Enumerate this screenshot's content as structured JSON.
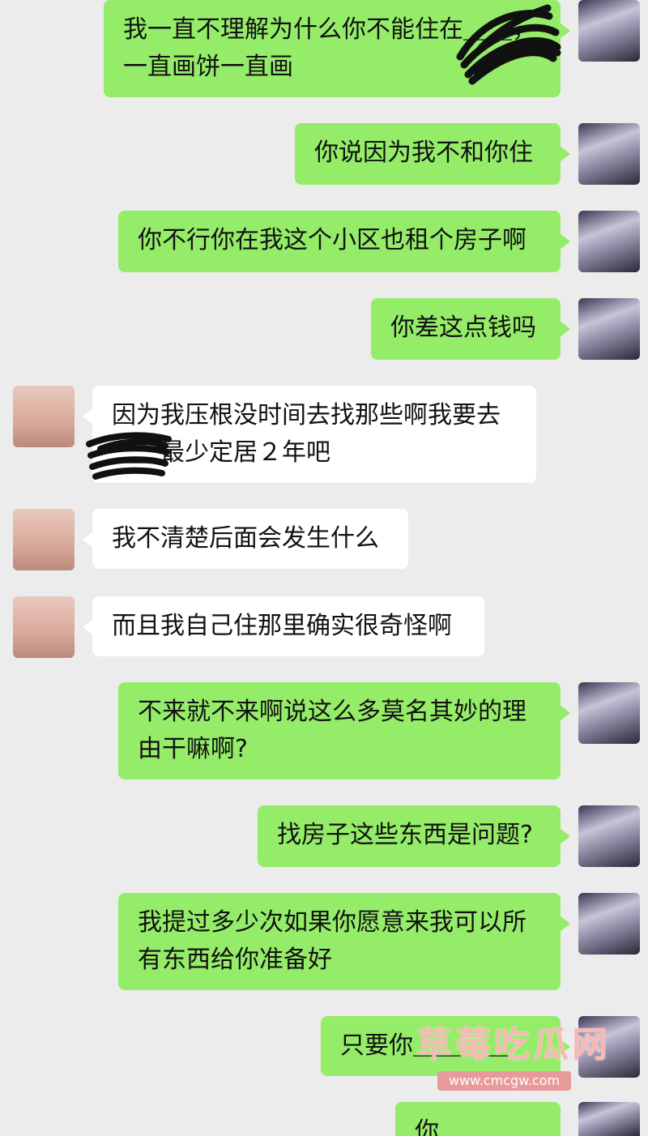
{
  "messages": [
    {
      "side": "me",
      "text": "我一直不理解为什么你不能住在＿＿，一直画饼一直画"
    },
    {
      "side": "me",
      "text": "你说因为我不和你住"
    },
    {
      "side": "me",
      "text": "你不行你在我这个小区也租个房子啊"
    },
    {
      "side": "me",
      "text": "你差这点钱吗"
    },
    {
      "side": "them",
      "text": "因为我压根没时间去找那些啊我要去＿＿最少定居２年吧"
    },
    {
      "side": "them",
      "text": "我不清楚后面会发生什么"
    },
    {
      "side": "them",
      "text": "而且我自己住那里确实很奇怪啊"
    },
    {
      "side": "me",
      "text": "不来就不来啊说这么多莫名其妙的理由干嘛啊?"
    },
    {
      "side": "me",
      "text": "找房子这些东西是问题?"
    },
    {
      "side": "me",
      "text": "我提过多少次如果你愿意来我可以所有东西给你准备好"
    },
    {
      "side": "me",
      "text": "只要你＿＿＿＿"
    },
    {
      "side": "me",
      "text": "你＿＿＿＿"
    }
  ],
  "watermark": {
    "title": "草莓吃瓜网",
    "url": "www.cmcgw.com"
  },
  "colors": {
    "me_bubble": "#95ec69",
    "them_bubble": "#ffffff",
    "background": "#ececec"
  },
  "avatars": {
    "me": "anime-girl-avatar",
    "them": "pig-avatar"
  }
}
